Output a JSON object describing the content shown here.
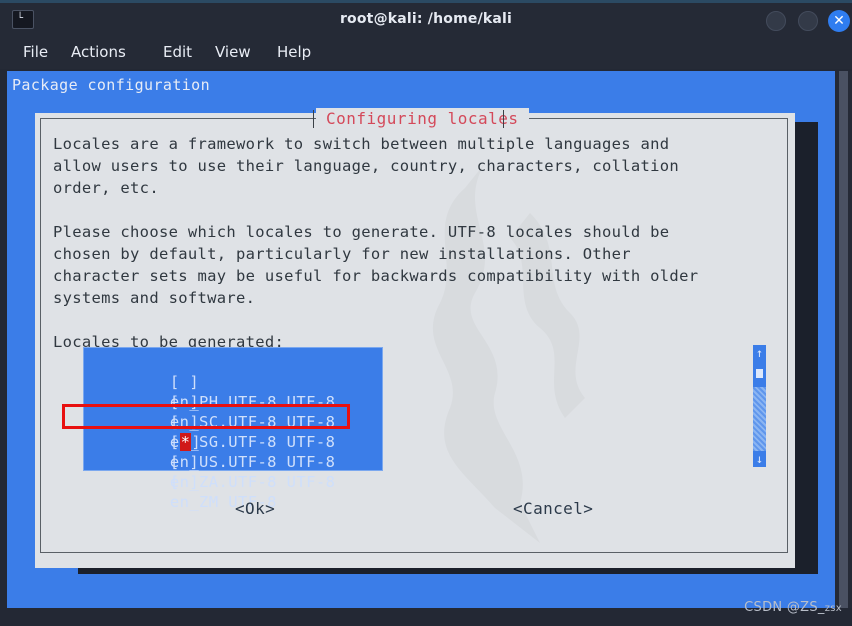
{
  "window": {
    "title": "root@kali: /home/kali",
    "app_icon": "terminal-icon",
    "controls": {
      "minimize": "",
      "maximize": "",
      "close": "✕"
    }
  },
  "menubar": {
    "items": [
      {
        "label": "File"
      },
      {
        "label": "Actions"
      },
      {
        "label": "Edit"
      },
      {
        "label": "View"
      },
      {
        "label": "Help"
      }
    ]
  },
  "terminal": {
    "header": "Package configuration",
    "background_color": "#3b7de8"
  },
  "dialog": {
    "title": "Configuring locales",
    "title_color": "#d4495a",
    "paragraphs": [
      "Locales are a framework to switch between multiple languages and",
      "allow users to use their language, country, characters, collation",
      "order, etc.",
      "Please choose which locales to generate. UTF-8 locales should be",
      "chosen by default, particularly for new installations. Other",
      "character sets may be useful for backwards compatibility with older",
      "systems and software.",
      "Locales to be generated:"
    ],
    "list": {
      "rows": [
        {
          "mark": " ",
          "label": "en_PH.UTF-8 UTF-8",
          "checked": false
        },
        {
          "mark": " ",
          "label": "en_SC.UTF-8 UTF-8",
          "checked": false
        },
        {
          "mark": " ",
          "label": "en_SG.UTF-8 UTF-8",
          "checked": false
        },
        {
          "mark": "*",
          "label": "en_US.UTF-8 UTF-8",
          "checked": true
        },
        {
          "mark": " ",
          "label": "en_ZA.UTF-8 UTF-8",
          "checked": false
        },
        {
          "mark": " ",
          "label": "en_ZM UTF-8",
          "checked": false
        }
      ],
      "highlight_color": "#3b7de8",
      "annotation_color": "#e81010"
    },
    "scrollbar": {
      "up_arrow": "↑",
      "down_arrow": "↓"
    },
    "buttons": {
      "ok": "<Ok>",
      "cancel": "<Cancel>"
    }
  },
  "watermark": {
    "prefix": "CSDN @ZS_",
    "suffix": "zsx"
  }
}
